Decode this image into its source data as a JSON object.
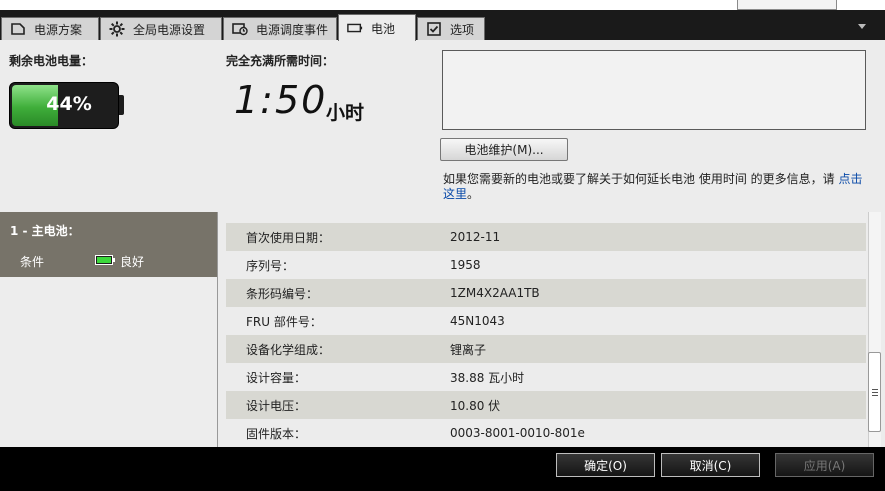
{
  "tabs": [
    {
      "label": "电源方案",
      "icon": "plan-icon"
    },
    {
      "label": "全局电源设置",
      "icon": "gear-icon"
    },
    {
      "label": "电源调度事件",
      "icon": "schedule-icon"
    },
    {
      "label": "电池",
      "icon": "battery-icon"
    },
    {
      "label": "选项",
      "icon": "checkbox-icon"
    }
  ],
  "top": {
    "remaining_label": "剩余电池电量：",
    "remaining_percent": "44%",
    "remaining_fraction": 0.44,
    "charge_label": "完全充满所需时间：",
    "charge_time": "1:50",
    "charge_unit": "小时",
    "maintenance_button": "电池维护(M)...",
    "help_text": "如果您需要新的电池或要了解关于如何延长电池 使用时间 的更多信息，请",
    "help_link": "点击这里",
    "help_suffix": "。"
  },
  "battery_list": {
    "title": "1 - 主电池：",
    "condition_label": "条件",
    "condition_value": "良好"
  },
  "details": [
    {
      "key": "首次使用日期：",
      "value": "2012-11"
    },
    {
      "key": "序列号：",
      "value": "1958"
    },
    {
      "key": "条形码编号：",
      "value": "1ZM4X2AA1TB"
    },
    {
      "key": "FRU 部件号：",
      "value": "45N1043"
    },
    {
      "key": "设备化学组成：",
      "value": "锂离子"
    },
    {
      "key": "设计容量：",
      "value": "38.88 瓦小时"
    },
    {
      "key": "设计电压：",
      "value": "10.80 伏"
    },
    {
      "key": "固件版本：",
      "value": "0003-8001-0010-801e"
    }
  ],
  "buttons": {
    "ok": "确定(O)",
    "cancel": "取消(C)",
    "apply": "应用(A)"
  },
  "colors": {
    "battery_fill": "#3fae3a",
    "link": "#0a4aa8",
    "list_header_bg": "#777369"
  }
}
